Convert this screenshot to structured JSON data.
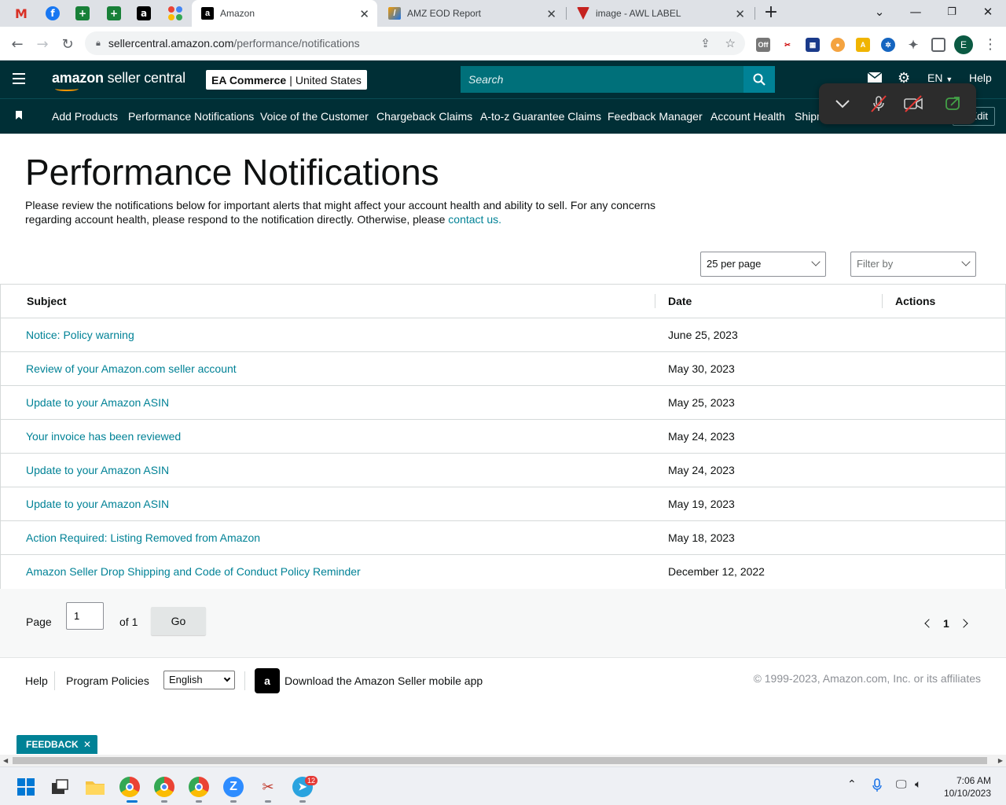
{
  "browser": {
    "tabs": [
      {
        "label": "Amazon",
        "active": true
      },
      {
        "label": "AMZ EOD Report",
        "active": false
      },
      {
        "label": "image - AWL LABEL",
        "active": false
      }
    ],
    "url_host": "sellercentral.amazon.com",
    "url_path": "/performance/notifications",
    "profile_initial": "E",
    "ext_off_badge": "Off"
  },
  "header": {
    "logo_brand": "amazon",
    "logo_product": "seller central",
    "account_name": "EA Commerce",
    "account_region": "United States",
    "search_placeholder": "Search",
    "language": "EN",
    "help": "Help"
  },
  "nav": {
    "items": [
      "Add Products",
      "Performance Notifications",
      "Voice of the Customer",
      "Chargeback Claims",
      "A-to-z Guarantee Claims",
      "Feedback Manager",
      "Account Health",
      "Shipm"
    ],
    "edit": "Edit"
  },
  "main": {
    "title": "Performance Notifications",
    "intro": "Please review the notifications below for important alerts that might affect your account health and ability to sell. For any concerns regarding account health, please respond to the notification directly. Otherwise, please ",
    "contact_link": "contact us.",
    "per_page": "25 per page",
    "filter_placeholder": "Filter by"
  },
  "table": {
    "headers": {
      "subject": "Subject",
      "date": "Date",
      "actions": "Actions"
    },
    "rows": [
      {
        "subject": "Notice: Policy warning",
        "date": "June 25, 2023"
      },
      {
        "subject": "Review of your Amazon.com seller account",
        "date": "May 30, 2023"
      },
      {
        "subject": "Update to your Amazon ASIN",
        "date": "May 25, 2023"
      },
      {
        "subject": "Your invoice has been reviewed",
        "date": "May 24, 2023"
      },
      {
        "subject": "Update to your Amazon ASIN",
        "date": "May 24, 2023"
      },
      {
        "subject": "Update to your Amazon ASIN",
        "date": "May 19, 2023"
      },
      {
        "subject": "Action Required: Listing Removed from Amazon",
        "date": "May 18, 2023"
      },
      {
        "subject": "Amazon Seller Drop Shipping and Code of Conduct Policy Reminder",
        "date": "December 12, 2022"
      }
    ]
  },
  "pager": {
    "page_label": "Page",
    "page_value": "1",
    "of_label": "of 1",
    "go": "Go",
    "current": "1"
  },
  "footer": {
    "help": "Help",
    "program_policies": "Program Policies",
    "language": "English",
    "app_text": "Download the Amazon Seller mobile app",
    "copyright": "© 1999-2023, Amazon.com, Inc. or its affiliates"
  },
  "feedback": "FEEDBACK",
  "taskbar": {
    "time": "7:06 AM",
    "date": "10/10/2023",
    "telegram_badge": "12"
  },
  "colors": {
    "header_bg": "#002f36",
    "link": "#008296",
    "search_bg": "#00707a"
  }
}
